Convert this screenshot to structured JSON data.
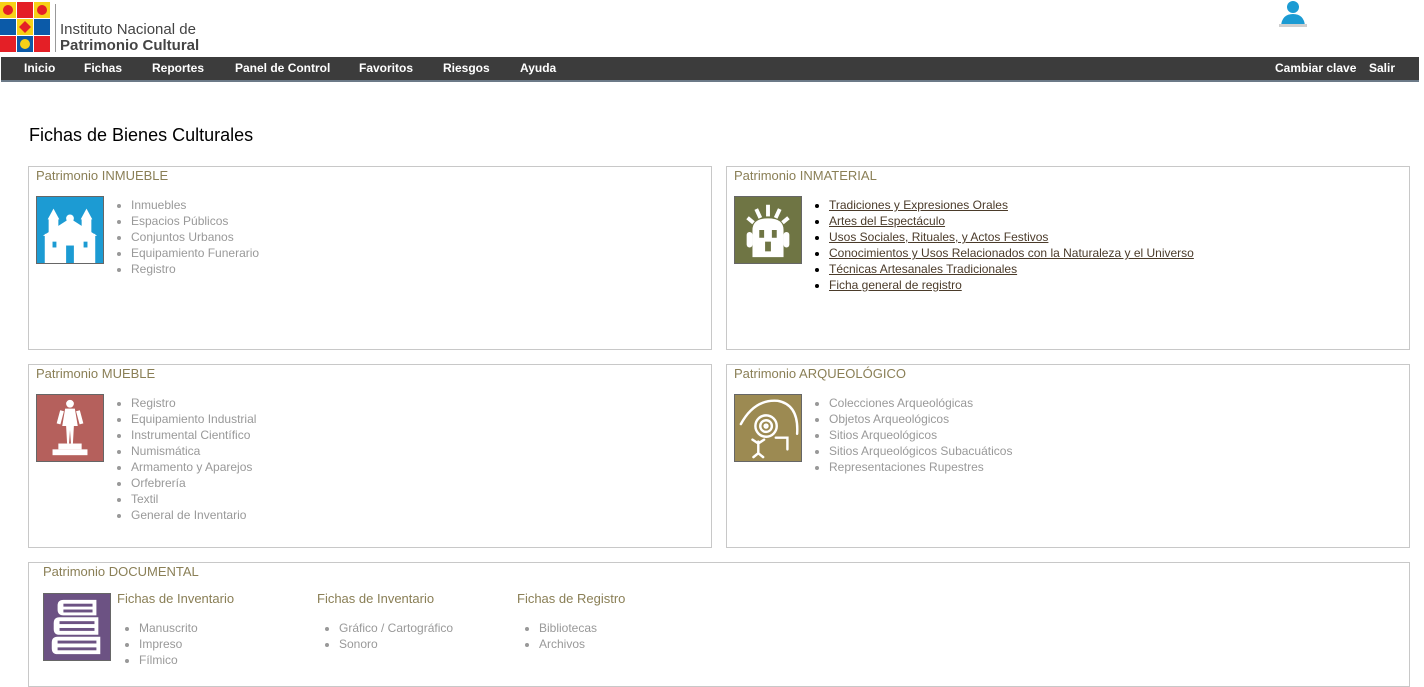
{
  "header": {
    "logo_line1": "Instituto Nacional de",
    "logo_line2": "Patrimonio Cultural"
  },
  "nav": {
    "items": [
      "Inicio",
      "Fichas",
      "Reportes",
      "Panel de Control",
      "Favoritos",
      "Riesgos",
      "Ayuda"
    ],
    "right": [
      "Cambiar clave",
      "Salir"
    ]
  },
  "page_title": "Fichas de Bienes Culturales",
  "panels": {
    "inmueble": {
      "title": "Patrimonio INMUEBLE",
      "color": "#1c9bd3",
      "items": [
        "Inmuebles",
        "Espacios Públicos",
        "Conjuntos Urbanos",
        "Equipamiento Funerario",
        "Registro"
      ]
    },
    "inmaterial": {
      "title": "Patrimonio INMATERIAL",
      "color": "#6f7544",
      "items": [
        "Tradiciones y Expresiones Orales",
        "Artes del Espectáculo",
        "Usos Sociales, Rituales, y Actos Festivos",
        "Conocimientos y Usos Relacionados con la Naturaleza y el Universo",
        "Técnicas Artesanales Tradicionales",
        "Ficha general de registro"
      ]
    },
    "mueble": {
      "title": "Patrimonio MUEBLE",
      "color": "#b5605c",
      "items": [
        "Registro",
        "Equipamiento Industrial",
        "Instrumental Científico",
        "Numismática",
        "Armamento y Aparejos",
        "Orfebrería",
        "Textil",
        "General de Inventario"
      ]
    },
    "arqueologico": {
      "title": "Patrimonio ARQUEOLÓGICO",
      "color": "#9c8a52",
      "items": [
        "Colecciones Arqueológicas",
        "Objetos Arqueológicos",
        "Sitios Arqueológicos",
        "Sitios Arqueológicos Subacuáticos",
        "Representaciones Rupestres"
      ]
    },
    "documental": {
      "title": "Patrimonio DOCUMENTAL",
      "color": "#6c5283",
      "columns": [
        {
          "title": "Fichas de Inventario",
          "items": [
            "Manuscrito",
            "Impreso",
            "Fílmico"
          ]
        },
        {
          "title": "Fichas de Inventario",
          "items": [
            "Gráfico / Cartográfico",
            "Sonoro"
          ]
        },
        {
          "title": "Fichas de Registro",
          "items": [
            "Bibliotecas",
            "Archivos"
          ]
        }
      ]
    }
  }
}
